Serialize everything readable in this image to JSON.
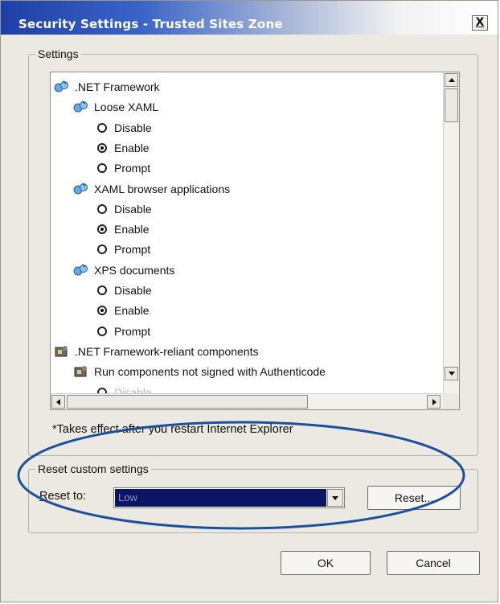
{
  "dialog": {
    "title": "Security Settings - Trusted Sites Zone",
    "close_label": "X"
  },
  "settings": {
    "group_label": "Settings",
    "items": [
      {
        "kind": "category",
        "label": ".NET Framework",
        "icon": "net-framework-icon"
      },
      {
        "kind": "setting",
        "label": "Loose XAML",
        "icon": "net-framework-icon"
      },
      {
        "kind": "option",
        "label": "Disable",
        "checked": false
      },
      {
        "kind": "option",
        "label": "Enable",
        "checked": true
      },
      {
        "kind": "option",
        "label": "Prompt",
        "checked": false
      },
      {
        "kind": "setting",
        "label": "XAML browser applications",
        "icon": "net-framework-icon"
      },
      {
        "kind": "option",
        "label": "Disable",
        "checked": false
      },
      {
        "kind": "option",
        "label": "Enable",
        "checked": true
      },
      {
        "kind": "option",
        "label": "Prompt",
        "checked": false
      },
      {
        "kind": "setting",
        "label": "XPS documents",
        "icon": "net-framework-icon"
      },
      {
        "kind": "option",
        "label": "Disable",
        "checked": false
      },
      {
        "kind": "option",
        "label": "Enable",
        "checked": true
      },
      {
        "kind": "option",
        "label": "Prompt",
        "checked": false
      },
      {
        "kind": "category",
        "label": ".NET Framework-reliant components",
        "icon": "components-icon"
      },
      {
        "kind": "setting",
        "label": "Run components not signed with Authenticode",
        "icon": "components-icon"
      },
      {
        "kind": "option",
        "label": "Disable",
        "checked": false
      }
    ],
    "footnote": "*Takes effect after you restart Internet Explorer"
  },
  "reset": {
    "group_label": "Reset custom settings",
    "label_prefix": "R",
    "label_rest": "eset to:",
    "selected_value": "Low",
    "reset_button": "Reset..."
  },
  "buttons": {
    "ok": "OK",
    "cancel": "Cancel"
  },
  "colors": {
    "highlight_ellipse": "#1c4f9c",
    "title_gradient_start": "#1e3fa6",
    "select_highlight": "#0c1466"
  }
}
